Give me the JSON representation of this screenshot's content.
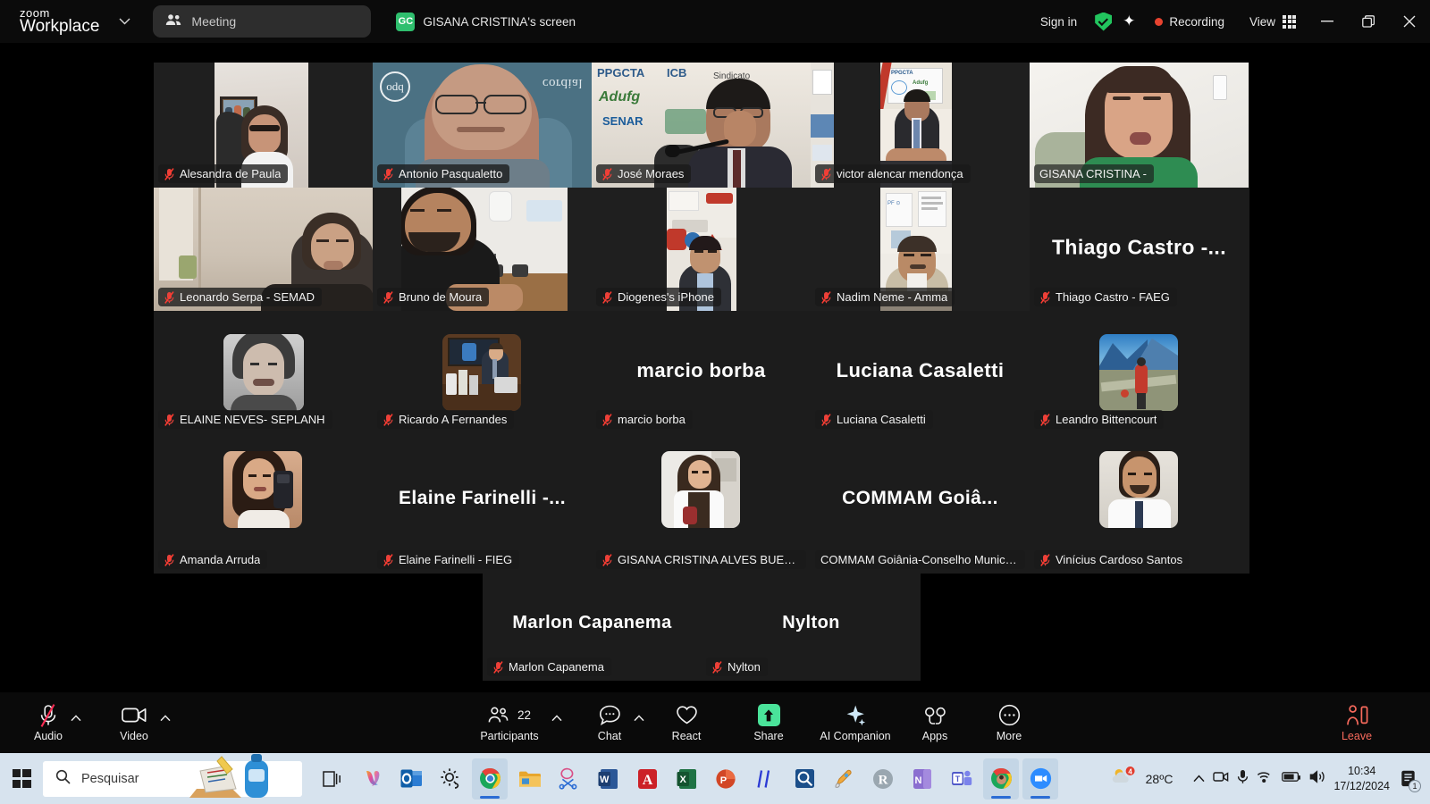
{
  "titlebar": {
    "brand_line1": "zoom",
    "brand_line2": "Workplace",
    "brand_chevron": "chevron-down",
    "meeting_pill_label": "Meeting",
    "share_badge": "GC",
    "share_label": "GISANA CRISTINA's screen",
    "sign_in": "Sign in",
    "recording_label": "Recording",
    "view_label": "View",
    "minimize": "minimize",
    "restore": "restore",
    "close": "close",
    "accent_green": "#22c55e",
    "recording_red": "#e8432f"
  },
  "stage": {
    "active_speaker_border": "#3ddc84",
    "participants": [
      {
        "name": "Alesandra de Paula",
        "muted": true,
        "kind": "video",
        "initials": ""
      },
      {
        "name": "Antonio Pasqualetto",
        "muted": true,
        "kind": "video",
        "initials": ""
      },
      {
        "name": "José Moraes",
        "muted": true,
        "kind": "video",
        "initials": ""
      },
      {
        "name": "victor alencar mendonça",
        "muted": true,
        "kind": "video",
        "initials": ""
      },
      {
        "name": "GISANA CRISTINA -",
        "muted": false,
        "kind": "video",
        "initials": "",
        "speaking": true
      },
      {
        "name": "Leonardo Serpa - SEMAD",
        "muted": true,
        "kind": "video",
        "initials": ""
      },
      {
        "name": "Bruno de Moura",
        "muted": true,
        "kind": "video",
        "initials": ""
      },
      {
        "name": "Diogenes's iPhone",
        "muted": true,
        "kind": "video",
        "initials": ""
      },
      {
        "name": "Nadim Neme - Amma",
        "muted": true,
        "kind": "video",
        "initials": ""
      },
      {
        "name": "Thiago Castro - FAEG",
        "muted": true,
        "kind": "name",
        "initials": "Thiago Castro -..."
      },
      {
        "name": "ELAINE NEVES- SEPLANH",
        "muted": true,
        "kind": "avatar",
        "initials": ""
      },
      {
        "name": "Ricardo A Fernandes",
        "muted": true,
        "kind": "avatar",
        "initials": ""
      },
      {
        "name": "marcio borba",
        "muted": true,
        "kind": "name",
        "initials": "marcio borba"
      },
      {
        "name": "Luciana Casaletti",
        "muted": true,
        "kind": "name",
        "initials": "Luciana Casaletti"
      },
      {
        "name": "Leandro Bittencourt",
        "muted": true,
        "kind": "avatar",
        "initials": ""
      },
      {
        "name": "Amanda Arruda",
        "muted": true,
        "kind": "avatar",
        "initials": ""
      },
      {
        "name": "Elaine Farinelli - FIEG",
        "muted": true,
        "kind": "name",
        "initials": "Elaine Farinelli -..."
      },
      {
        "name": "GISANA CRISTINA ALVES BUENO",
        "muted": true,
        "kind": "avatar",
        "initials": ""
      },
      {
        "name": "COMMAM Goiânia-Conselho Municipal ...",
        "muted": false,
        "kind": "name",
        "initials": "COMMAM Goiâ..."
      },
      {
        "name": "Vinícius Cardoso Santos",
        "muted": true,
        "kind": "avatar",
        "initials": ""
      },
      {
        "name": "Marlon Capanema",
        "muted": true,
        "kind": "name",
        "initials": "Marlon Capanema"
      },
      {
        "name": "Nylton",
        "muted": true,
        "kind": "name",
        "initials": "Nylton"
      }
    ]
  },
  "toolbar": {
    "audio_label": "Audio",
    "video_label": "Video",
    "participants_label": "Participants",
    "participants_count": "22",
    "chat_label": "Chat",
    "react_label": "React",
    "share_label": "Share",
    "ai_companion_label": "AI Companion",
    "apps_label": "Apps",
    "more_label": "More",
    "leave_label": "Leave",
    "share_green": "#4ae39a",
    "leave_red": "#f86a5c"
  },
  "taskbar": {
    "search_placeholder": "Pesquisar",
    "temperature": "28ºC",
    "time": "10:34",
    "date": "17/12/2024",
    "notification_count": "1",
    "apps": [
      "task-view-icon",
      "copilot-icon",
      "outlook-icon",
      "settings-icon",
      "chrome-icon",
      "file-explorer-icon",
      "snipping-tool-icon",
      "word-icon",
      "acrobat-icon",
      "excel-icon",
      "powerpoint-icon",
      "hashtag-icon",
      "magnifier-app-icon",
      "paint-icon",
      "rstudio-icon",
      "onenote-icon",
      "teams-icon",
      "chrome-profile-icon",
      "zoom-icon"
    ]
  }
}
